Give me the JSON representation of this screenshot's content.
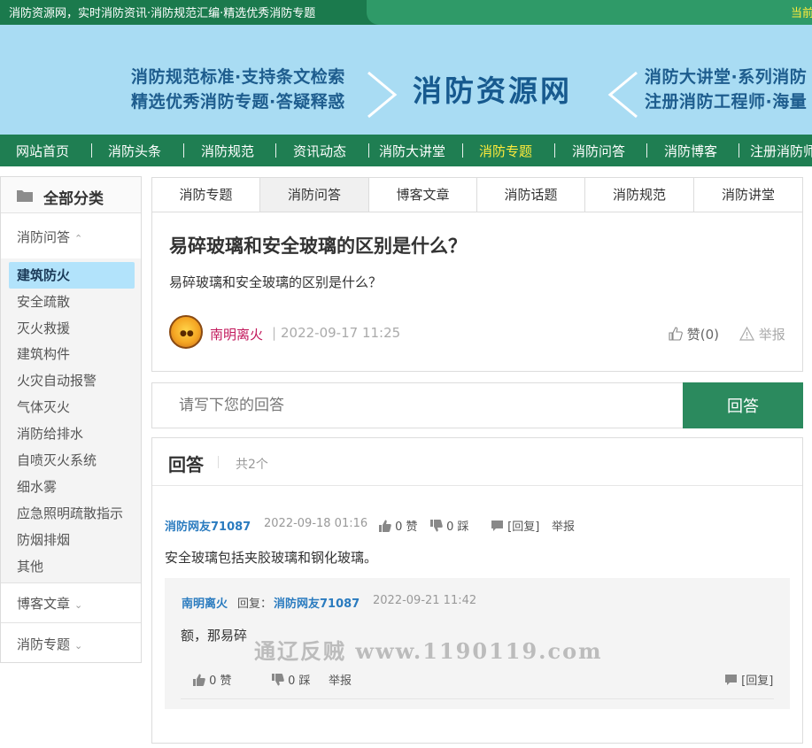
{
  "topbar": {
    "tagline": "消防资源网，实时消防资讯·消防规范汇编·精选优秀消防专题",
    "right_text": "当前"
  },
  "banner": {
    "slogan_left_1": "消防规范标准·支持条文检索",
    "slogan_left_2": "精选优秀消防专题·答疑释惑",
    "brand": "消防资源网",
    "slogan_right_1": "消防大讲堂·系列消防",
    "slogan_right_2": "注册消防工程师·海量"
  },
  "nav": {
    "items": [
      {
        "label": "网站首页"
      },
      {
        "label": "消防头条"
      },
      {
        "label": "消防规范"
      },
      {
        "label": "资讯动态"
      },
      {
        "label": "消防大讲堂"
      },
      {
        "label": "消防专题"
      },
      {
        "label": "消防问答"
      },
      {
        "label": "消防博客"
      },
      {
        "label": "注册消防师"
      }
    ],
    "active_index": 5
  },
  "sidebar": {
    "title": "全部分类",
    "cat_qa": "消防问答",
    "subcats": [
      "建筑防火",
      "安全疏散",
      "灭火救援",
      "建筑构件",
      "火灾自动报警",
      "气体灭火",
      "消防给排水",
      "自喷灭火系统",
      "细水雾",
      "应急照明疏散指示",
      "防烟排烟",
      "其他"
    ],
    "active_subcat": 0,
    "cat_blog": "博客文章",
    "cat_topic": "消防专题"
  },
  "tabs": {
    "items": [
      "消防专题",
      "消防问答",
      "博客文章",
      "消防话题",
      "消防规范",
      "消防讲堂"
    ],
    "active_index": 1
  },
  "question": {
    "title": "易碎玻璃和安全玻璃的区别是什么？",
    "description": "易碎玻璃和安全玻璃的区别是什么？",
    "author": "南明离火",
    "separator": "|",
    "time": "2022-09-17 11:25",
    "like_label": "赞(0)",
    "report_label": "举报"
  },
  "answer_form": {
    "placeholder": "请写下您的回答",
    "submit_label": "回答"
  },
  "answers": {
    "title": "回答",
    "count_label": "共2个",
    "items": [
      {
        "user": "消防网友71087",
        "time": "2022-09-18 01:16",
        "likes": "0 赞",
        "dislikes": "0 踩",
        "reply_label": "[回复]",
        "report_label": "举报",
        "text": "安全玻璃包括夹胶玻璃和钢化玻璃。",
        "reply": {
          "user": "南明离火",
          "reply_word": "回复：",
          "target": "消防网友71087",
          "time": "2022-09-21 11:42",
          "text": "额，那易碎",
          "likes": "0 赞",
          "dislikes": "0 踩",
          "report_label": "举报",
          "reply_label": "[回复]"
        }
      }
    ]
  },
  "watermark": "通辽反贼 www.1190119.com",
  "colors": {
    "nav_bg": "#1f7e52",
    "banner_bg": "#a9dcf3",
    "accent_green": "#2b8a5e",
    "active_nav": "#ffeb3b",
    "user_blue": "#2a7bbf",
    "author_red": "#c2185b"
  }
}
